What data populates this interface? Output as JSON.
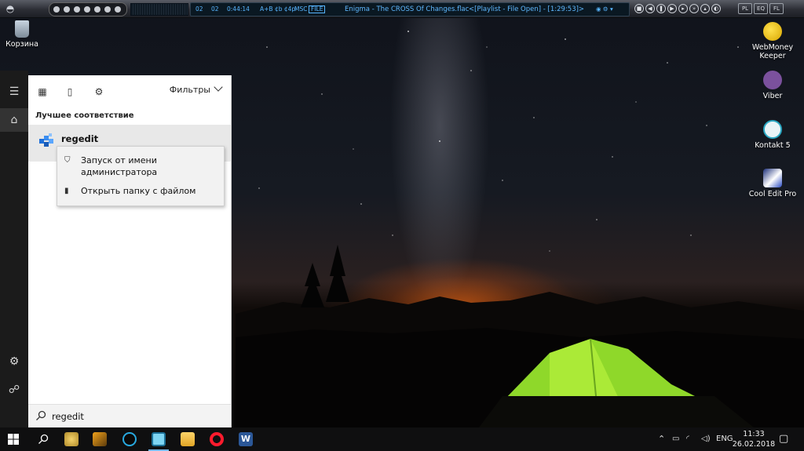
{
  "media_player": {
    "display_counter_1": "02",
    "display_counter_2": "02",
    "display_time": "0:44:14",
    "display_flags": "A+B  ¢b  ¢4p",
    "display_mode": "MSC",
    "display_badge": "FILE",
    "track_title": "Enigma - The CROSS Of Changes.flac",
    "status": "<[Playlist - File Open] - [1:29:53]>"
  },
  "desktop_icons": [
    {
      "label": "Корзина"
    },
    {
      "label": "WebMoney Keeper"
    },
    {
      "label": "Viber"
    },
    {
      "label": "Kontakt 5"
    },
    {
      "label": "Cool Edit Pro"
    }
  ],
  "start_menu": {
    "filters_label": "Фильтры",
    "best_match_label": "Лучшее соответствие",
    "best_match_result": "regedit",
    "context_menu": {
      "run_as_admin": "Запуск от имени администратора",
      "open_file_location": "Открыть папку с файлом"
    },
    "search_value": "regedit"
  },
  "taskbar": {
    "language": "ENG",
    "time": "11:33",
    "date": "26.02.2018"
  },
  "colors": {
    "taskbar_bg": "#0f0f10",
    "start_rail_bg": "#1b1b1b",
    "selection_bg": "#e8e8e8",
    "accent": "#76b9ed",
    "media_text": "#58b5ff"
  }
}
